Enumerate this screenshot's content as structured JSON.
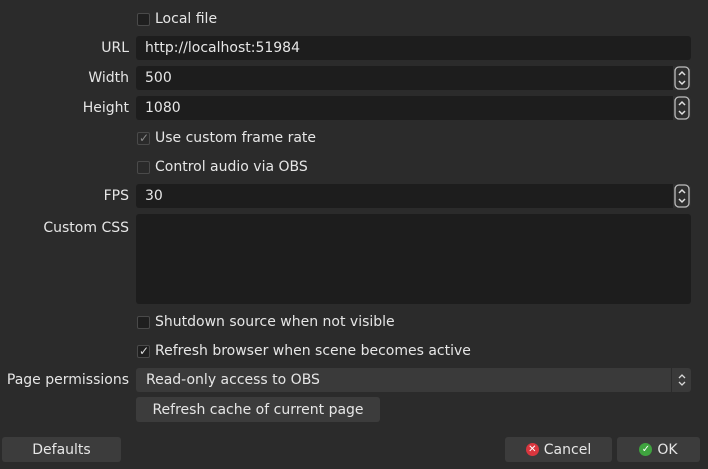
{
  "local_file": {
    "label": "Local file",
    "checked": false
  },
  "url": {
    "label": "URL",
    "value": "http://localhost:51984"
  },
  "width": {
    "label": "Width",
    "value": "500"
  },
  "height": {
    "label": "Height",
    "value": "1080"
  },
  "custom_frame_rate": {
    "label": "Use custom frame rate",
    "checked": true,
    "disabled": true
  },
  "control_audio": {
    "label": "Control audio via OBS",
    "checked": false,
    "disabled": true
  },
  "fps": {
    "label": "FPS",
    "value": "30"
  },
  "custom_css": {
    "label": "Custom CSS",
    "value": ""
  },
  "shutdown_source": {
    "label": "Shutdown source when not visible",
    "checked": false
  },
  "refresh_browser": {
    "label": "Refresh browser when scene becomes active",
    "checked": true
  },
  "page_permissions": {
    "label": "Page permissions",
    "value": "Read-only access to OBS"
  },
  "refresh_cache_button": "Refresh cache of current page",
  "footer": {
    "defaults_label": "Defaults",
    "cancel_label": "Cancel",
    "ok_label": "OK"
  },
  "colors": {
    "background": "#2b2b2b",
    "input_bg": "#1d1d1d",
    "button_bg": "#3c3c3c",
    "cancel_icon": "#d9363e",
    "ok_icon": "#3fa33f"
  }
}
